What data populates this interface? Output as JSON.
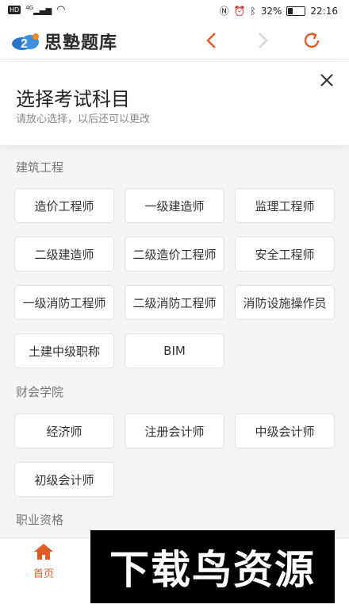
{
  "status_bar": {
    "network": "HD",
    "signal": "4G",
    "battery": "32%",
    "battery_level": 0.32,
    "time": "22:16"
  },
  "app_bar": {
    "logo_text": "思塾题库",
    "icons": [
      "back-icon",
      "forward-icon",
      "refresh-icon"
    ],
    "accent": "#e05c27"
  },
  "sheet": {
    "title": "选择考试科目",
    "subtitle": "请放心选择，以后还可以更改"
  },
  "sections": [
    {
      "label": "建筑工程",
      "items": [
        "造价工程师",
        "一级建造师",
        "监理工程师",
        "二级建造师",
        "二级造价工程师",
        "安全工程师",
        "一级消防工程师",
        "二级消防工程师",
        "消防设施操作员",
        "土建中级职称",
        "BIM"
      ]
    },
    {
      "label": "财会学院",
      "items": [
        "经济师",
        "注册会计师",
        "中级会计师",
        "初级会计师"
      ]
    },
    {
      "label": "职业资格",
      "items": []
    }
  ],
  "tab_bar": {
    "home_label": "首页"
  },
  "watermark": {
    "text": "下载鸟资源"
  }
}
